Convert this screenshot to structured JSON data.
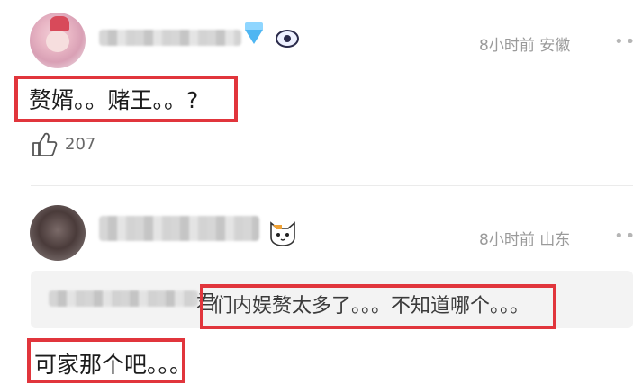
{
  "comments": [
    {
      "location_time": "8小时前 安徽",
      "text": "赘婿。。赌王。。?",
      "likes": "207",
      "more": "••"
    },
    {
      "location_time": "8小时前 山东",
      "quote_fragment": "君",
      "quote_text": "们内娱赘太多了。。。不知道哪个。。。",
      "text": "可家那个吧。。。",
      "more": "••"
    }
  ],
  "icons": [
    "avatar",
    "diamond-badge-icon",
    "eye-badge-icon",
    "like-icon",
    "cat-emoji-icon",
    "more-icon"
  ],
  "colors": {
    "highlight_box": "#e1353c",
    "meta_text": "#9a9a9a",
    "reply_bg": "#f3f3f3"
  }
}
